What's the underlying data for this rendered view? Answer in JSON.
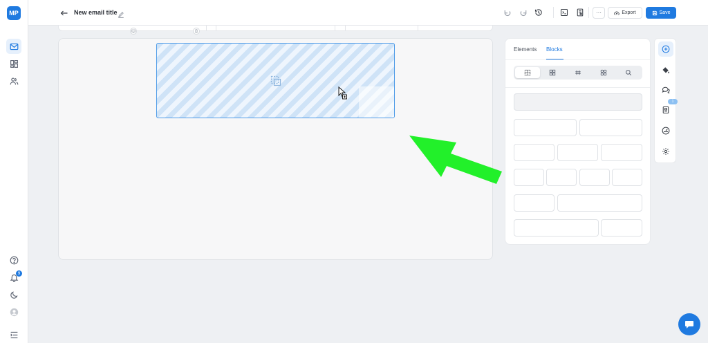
{
  "app": {
    "logo_text": "MP"
  },
  "header": {
    "title": "New email title",
    "more_label": "···",
    "export_label": "Export",
    "save_label": "Save"
  },
  "panel": {
    "tabs": [
      {
        "label": "Elements",
        "active": false
      },
      {
        "label": "Blocks",
        "active": true
      }
    ],
    "segments": [
      "layout-icon",
      "widgets-icon",
      "columns-icon",
      "grid-icon",
      "search-icon"
    ],
    "block_rows": [
      {
        "columns": 1
      },
      {
        "columns": 2
      },
      {
        "columns": 3
      },
      {
        "columns": 4
      },
      {
        "columns": "1:2"
      },
      {
        "columns": "2:1"
      }
    ]
  },
  "right_toolbar": {
    "badge_count": "1"
  },
  "sidebar": {
    "notification_count": "9"
  },
  "colors": {
    "accent": "#1f7ae0",
    "drop_stripe": "#cfe3f7",
    "annotation_arrow": "#22f02a"
  }
}
